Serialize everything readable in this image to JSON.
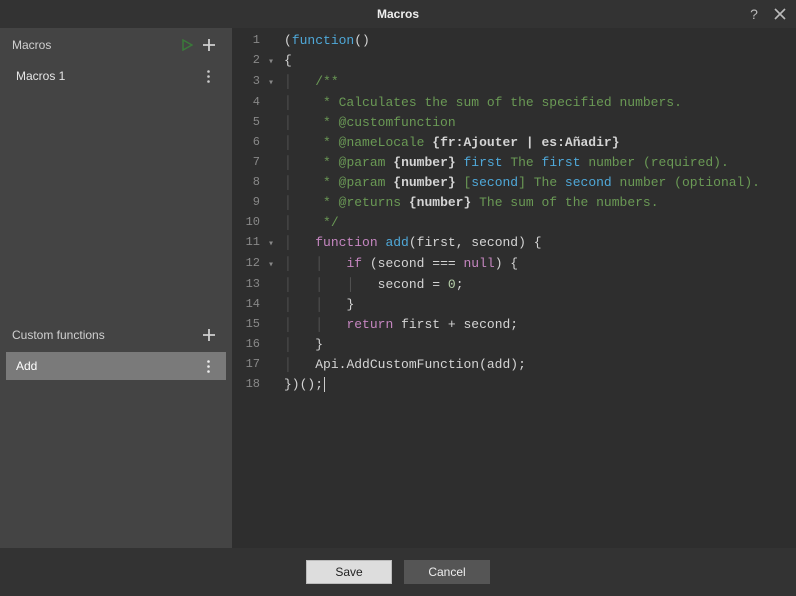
{
  "dialog": {
    "title": "Macros",
    "help_icon": "?",
    "close_icon": "×"
  },
  "sidebar": {
    "macros": {
      "label": "Macros",
      "items": [
        {
          "name": "Macros 1",
          "selected": false
        }
      ]
    },
    "custom_functions": {
      "label": "Custom functions",
      "items": [
        {
          "name": "Add",
          "selected": true
        }
      ]
    }
  },
  "editor": {
    "lines": [
      {
        "n": 1,
        "fold": "",
        "raw": "(function()"
      },
      {
        "n": 2,
        "fold": "▾",
        "raw": "{"
      },
      {
        "n": 3,
        "fold": "▾",
        "raw": "    /**"
      },
      {
        "n": 4,
        "fold": "",
        "raw": "     * Calculates the sum of the specified numbers."
      },
      {
        "n": 5,
        "fold": "",
        "raw": "     * @customfunction"
      },
      {
        "n": 6,
        "fold": "",
        "raw": "     * @nameLocale {fr:Ajouter | es:Añadir}"
      },
      {
        "n": 7,
        "fold": "",
        "raw": "     * @param {number} first The first number (required)."
      },
      {
        "n": 8,
        "fold": "",
        "raw": "     * @param {number} [second] The second number (optional)."
      },
      {
        "n": 9,
        "fold": "",
        "raw": "     * @returns {number} The sum of the numbers."
      },
      {
        "n": 10,
        "fold": "",
        "raw": "     */"
      },
      {
        "n": 11,
        "fold": "▾",
        "raw": "    function add(first, second) {"
      },
      {
        "n": 12,
        "fold": "▾",
        "raw": "        if (second === null) {"
      },
      {
        "n": 13,
        "fold": "",
        "raw": "            second = 0;"
      },
      {
        "n": 14,
        "fold": "",
        "raw": "        }"
      },
      {
        "n": 15,
        "fold": "",
        "raw": "        return first + second;"
      },
      {
        "n": 16,
        "fold": "",
        "raw": "    }"
      },
      {
        "n": 17,
        "fold": "",
        "raw": "    Api.AddCustomFunction(add);"
      },
      {
        "n": 18,
        "fold": "",
        "raw": "})();"
      }
    ]
  },
  "footer": {
    "save": "Save",
    "cancel": "Cancel"
  }
}
